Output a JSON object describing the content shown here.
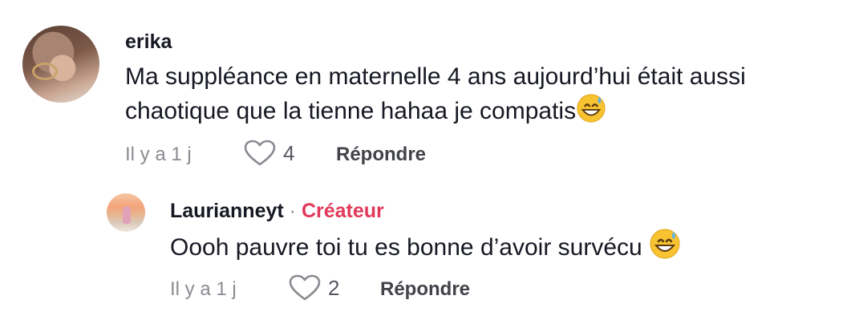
{
  "comments": [
    {
      "username": "erika",
      "text": [
        "Ma suppléance en maternelle 4 ans aujourd’hui était aussi",
        "chaotique que la tienne hahaa je compatis"
      ],
      "time": "Il y a 1 j",
      "likes": "4",
      "reply_label": "Répondre",
      "emoji": "grinning-sweat-emoji"
    },
    {
      "username": "Laurianneyt",
      "separator": "·",
      "creator_badge": "Créateur",
      "text": "Oooh pauvre toi tu es bonne d’avoir survécu",
      "time": "Il y a 1 j",
      "likes": "2",
      "reply_label": "Répondre",
      "emoji": "grinning-sweat-emoji"
    }
  ],
  "colors": {
    "creator": "#e1395a",
    "meta": "#8a8b91",
    "text": "#161823"
  },
  "icons": {
    "like": "heart-outline-icon"
  }
}
